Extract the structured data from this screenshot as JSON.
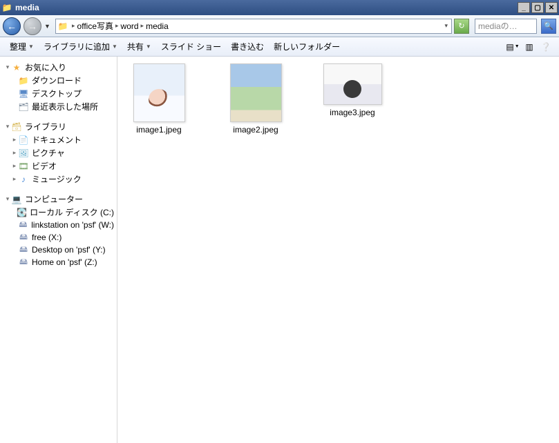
{
  "window": {
    "title": "media"
  },
  "nav": {
    "crumbs": [
      "office写真",
      "word",
      "media"
    ],
    "search_placeholder": "mediaの…"
  },
  "toolbar": {
    "organize": "整理",
    "add_to_library": "ライブラリに追加",
    "share": "共有",
    "slideshow": "スライド ショー",
    "burn": "書き込む",
    "new_folder": "新しいフォルダー"
  },
  "sidebar": {
    "favorites": {
      "label": "お気に入り",
      "items": [
        {
          "label": "ダウンロード",
          "icon": "folder"
        },
        {
          "label": "デスクトップ",
          "icon": "desktop"
        },
        {
          "label": "最近表示した場所",
          "icon": "recent"
        }
      ]
    },
    "libraries": {
      "label": "ライブラリ",
      "items": [
        {
          "label": "ドキュメント",
          "icon": "doc"
        },
        {
          "label": "ピクチャ",
          "icon": "pic"
        },
        {
          "label": "ビデオ",
          "icon": "vid"
        },
        {
          "label": "ミュージック",
          "icon": "music"
        }
      ]
    },
    "computer": {
      "label": "コンピューター",
      "items": [
        {
          "label": "ローカル ディスク (C:)",
          "icon": "drive"
        },
        {
          "label": "linkstation on 'psf' (W:)",
          "icon": "netdrive"
        },
        {
          "label": "free (X:)",
          "icon": "netdrive"
        },
        {
          "label": "Desktop on 'psf' (Y:)",
          "icon": "netdrive"
        },
        {
          "label": "Home on 'psf' (Z:)",
          "icon": "netdrive"
        }
      ]
    }
  },
  "files": [
    {
      "name": "image1.jpeg",
      "shape": "tall"
    },
    {
      "name": "image2.jpeg",
      "shape": "tall"
    },
    {
      "name": "image3.jpeg",
      "shape": "wide"
    }
  ]
}
